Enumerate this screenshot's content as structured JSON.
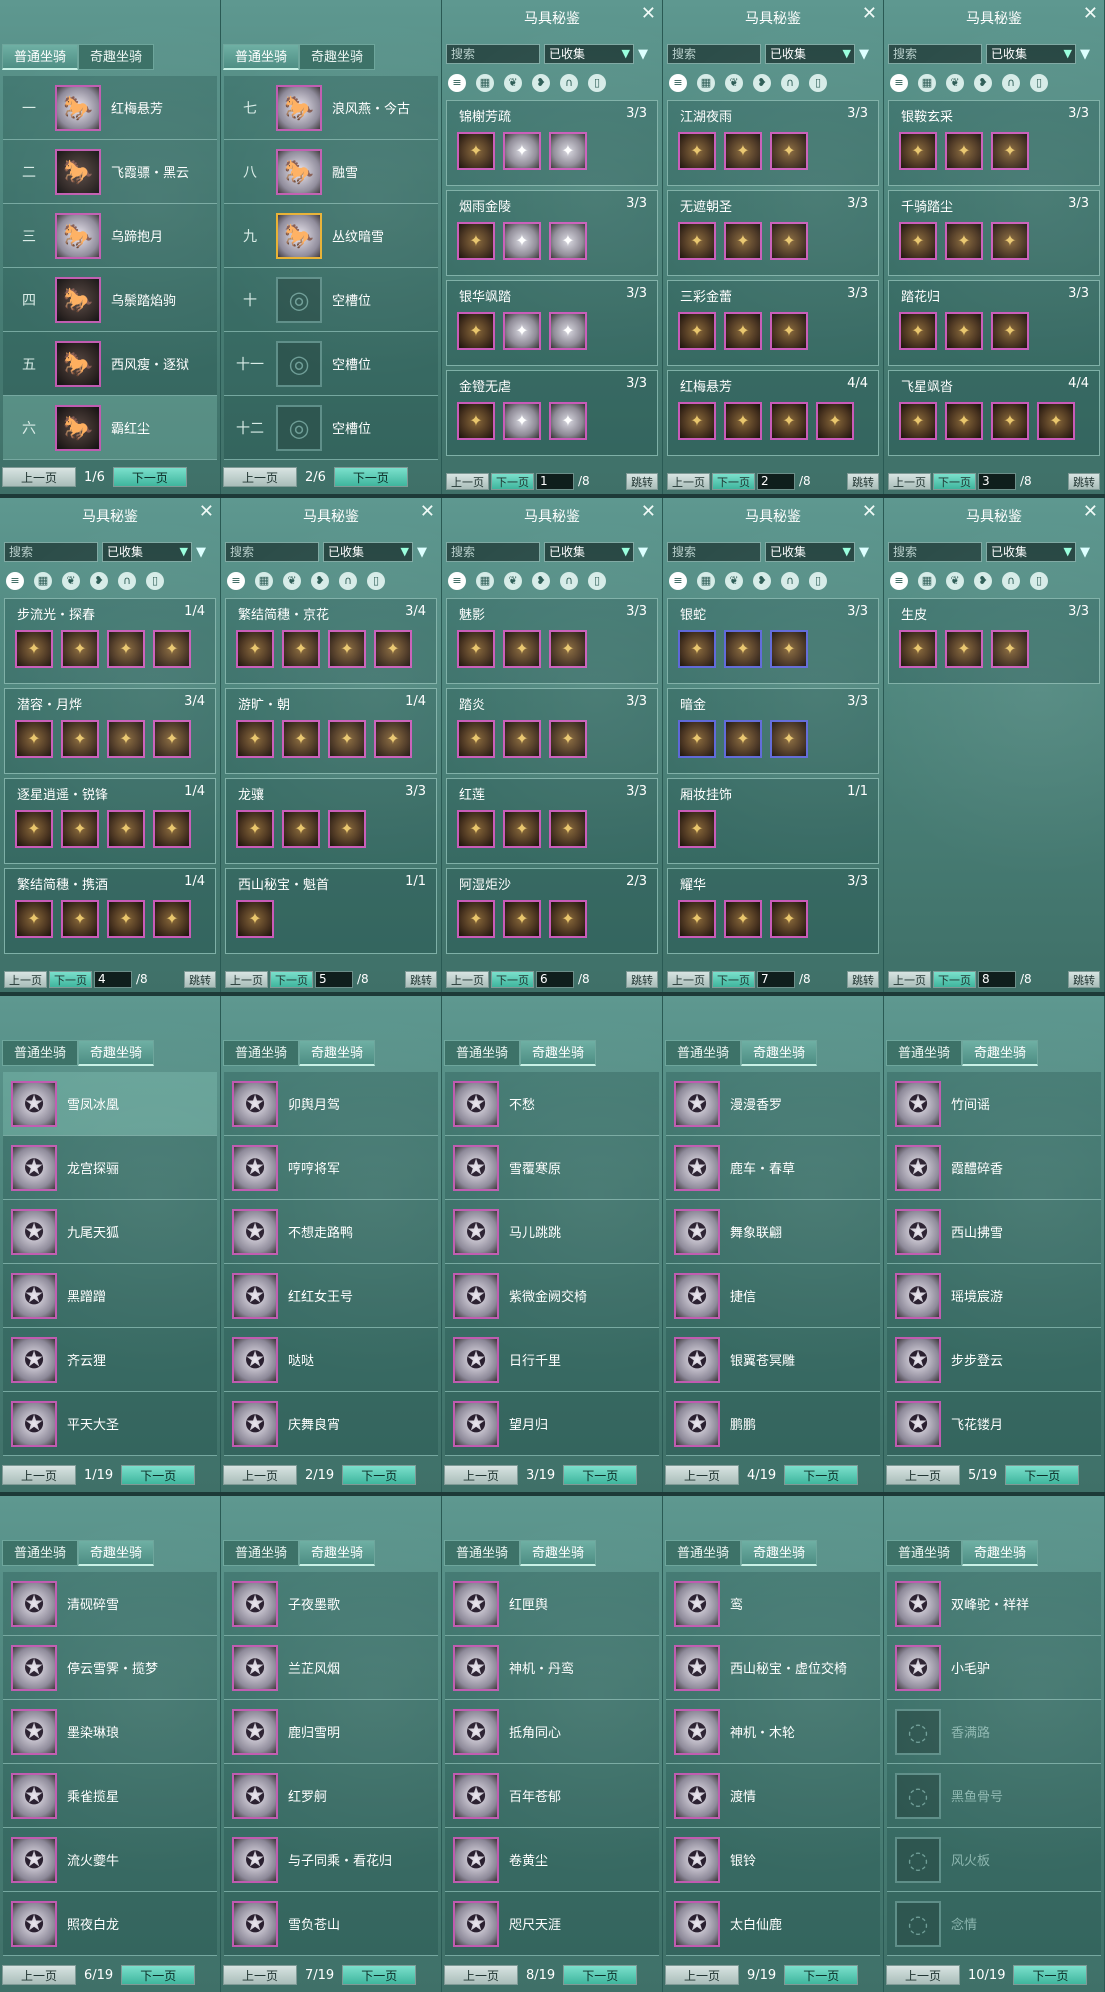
{
  "ui": {
    "tab_normal": "普通坐骑",
    "tab_fun": "奇趣坐骑",
    "prev": "上一页",
    "next": "下一页",
    "title": "马具秘鉴",
    "search": "搜索",
    "collected": "已收集",
    "jump": "跳转",
    "close": "✕",
    "total": "/8"
  },
  "normal": [
    {
      "page": "1/6",
      "rows": [
        [
          "一",
          "红梅悬芳"
        ],
        [
          "二",
          "飞霞骠・黑云"
        ],
        [
          "三",
          "乌蹄抱月"
        ],
        [
          "四",
          "乌鬃踏焰驹"
        ],
        [
          "五",
          "西风瘦・逐狱"
        ],
        [
          "六",
          "霸红尘"
        ]
      ]
    },
    {
      "page": "2/6",
      "rows": [
        [
          "七",
          "浪风燕・今古"
        ],
        [
          "八",
          "融雪"
        ],
        [
          "九",
          "丛纹暗雪"
        ],
        [
          "十",
          "空槽位"
        ],
        [
          "十一",
          "空槽位"
        ],
        [
          "十二",
          "空槽位"
        ]
      ]
    }
  ],
  "archive": [
    {
      "page": "1",
      "groups": [
        [
          "锦榭芳疏",
          "3/3",
          3
        ],
        [
          "烟雨金陵",
          "3/3",
          3
        ],
        [
          "银华飒踏",
          "3/3",
          3
        ],
        [
          "金镫无虐",
          "3/3",
          3
        ]
      ]
    },
    {
      "page": "2",
      "groups": [
        [
          "江湖夜雨",
          "3/3",
          3
        ],
        [
          "无遮朝圣",
          "3/3",
          3
        ],
        [
          "三彩金蕾",
          "3/3",
          3
        ],
        [
          "红梅悬芳",
          "4/4",
          4
        ]
      ]
    },
    {
      "page": "3",
      "groups": [
        [
          "银鞍玄采",
          "3/3",
          3
        ],
        [
          "千骑踏尘",
          "3/3",
          3
        ],
        [
          "踏花归",
          "3/3",
          3
        ],
        [
          "飞星飒沓",
          "4/4",
          4
        ]
      ]
    },
    {
      "page": "4",
      "groups": [
        [
          "步流光・探春",
          "1/4",
          4
        ],
        [
          "潜容・月烨",
          "3/4",
          4
        ],
        [
          "逐星逍遥・锐锋",
          "1/4",
          4
        ],
        [
          "繁结简穗・携酒",
          "1/4",
          4
        ]
      ]
    },
    {
      "page": "5",
      "groups": [
        [
          "繁结简穗・京花",
          "3/4",
          4
        ],
        [
          "游旷・朝",
          "1/4",
          4
        ],
        [
          "龙骧",
          "3/3",
          3
        ],
        [
          "西山秘宝・魁首",
          "1/1",
          1
        ]
      ]
    },
    {
      "page": "6",
      "groups": [
        [
          "魅影",
          "3/3",
          3
        ],
        [
          "踏炎",
          "3/3",
          3
        ],
        [
          "红莲",
          "3/3",
          3
        ],
        [
          "阿湿炬沙",
          "2/3",
          3
        ]
      ]
    },
    {
      "page": "7",
      "groups": [
        [
          "银蛇",
          "3/3",
          3
        ],
        [
          "暗金",
          "3/3",
          3
        ],
        [
          "厢妆挂饰",
          "1/1",
          1
        ],
        [
          "耀华",
          "3/3",
          3
        ]
      ]
    },
    {
      "page": "8",
      "groups": [
        [
          "生皮",
          "3/3",
          3
        ]
      ]
    }
  ],
  "fun1": [
    {
      "page": "1/19",
      "rows": [
        "雪凤冰凰",
        "龙宫探骊",
        "九尾天狐",
        "黑蹭蹭",
        "齐云狸",
        "平天大圣"
      ]
    },
    {
      "page": "2/19",
      "rows": [
        "卯舆月驾",
        "哼哼将军",
        "不想走路鸭",
        "红红女王号",
        "哒哒",
        "庆舞良宵"
      ]
    },
    {
      "page": "3/19",
      "rows": [
        "不愁",
        "雪覆寒原",
        "马儿跳跳",
        "紫微金阙交椅",
        "日行千里",
        "望月归"
      ]
    },
    {
      "page": "4/19",
      "rows": [
        "漫漫香罗",
        "鹿车・春草",
        "舞象联翩",
        "捷信",
        "银翼苍冥雕",
        "鹏鹏"
      ]
    },
    {
      "page": "5/19",
      "rows": [
        "竹间谣",
        "霞醴碎香",
        "西山拂雪",
        "瑶境宸游",
        "步步登云",
        "飞花镂月"
      ]
    }
  ],
  "fun2": [
    {
      "page": "6/19",
      "rows": [
        "清砚碎雪",
        "停云雪霁・揽梦",
        "墨染琳琅",
        "乘雀揽星",
        "流火夔牛",
        "照夜白龙"
      ]
    },
    {
      "page": "7/19",
      "rows": [
        "子夜墨歌",
        "兰芷风烟",
        "鹿归雪明",
        "红罗舸",
        "与子同乘・看花归",
        "雪负苍山"
      ]
    },
    {
      "page": "8/19",
      "rows": [
        "红匣舆",
        "神机・丹鸾",
        "抵角同心",
        "百年苍郁",
        "卷黄尘",
        "咫尺天涯"
      ]
    },
    {
      "page": "9/19",
      "rows": [
        "鸾",
        "西山秘宝・虚位交椅",
        "神机・木轮",
        "渡情",
        "银铃",
        "太白仙鹿"
      ]
    },
    {
      "page": "10/19",
      "rows": [
        "双峰驼・祥祥",
        "小毛驴",
        "香满路",
        "黑鱼骨号",
        "风火板",
        "念情"
      ]
    }
  ]
}
